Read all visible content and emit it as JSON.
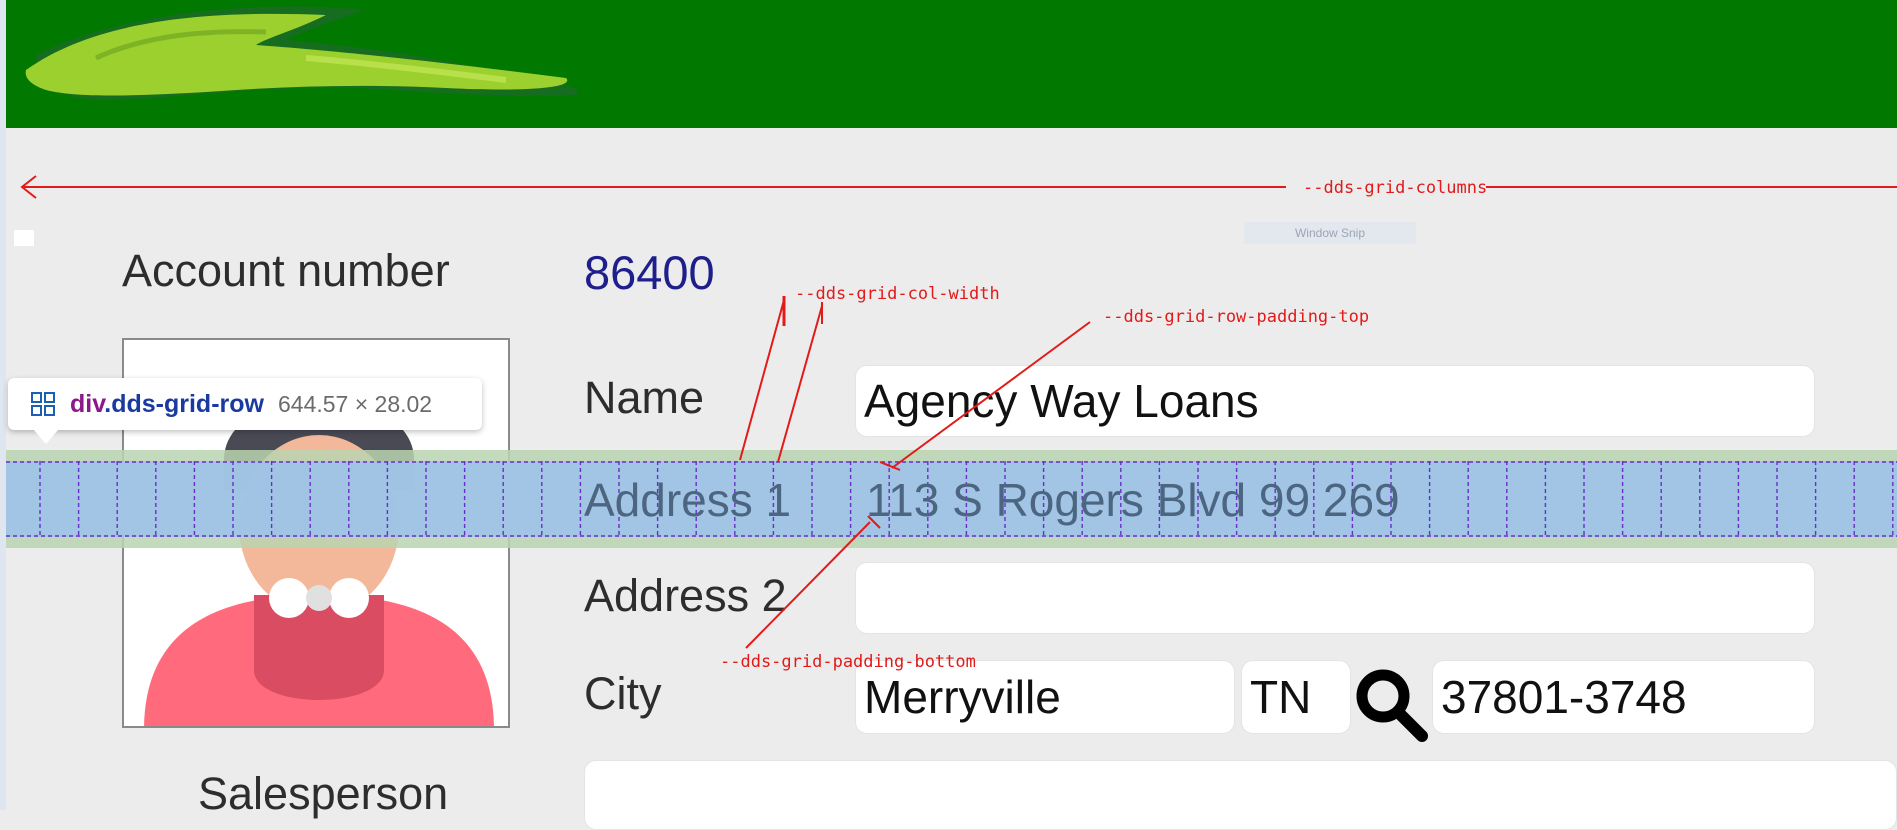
{
  "devtools": {
    "element_tag": "div",
    "element_class": ".dds-grid-row",
    "element_dims": "644.57 × 28.02"
  },
  "annotations": {
    "grid_columns": "--dds-grid-columns",
    "col_width": "--dds-grid-col-width",
    "row_padding_top": "--dds-grid-row-padding-top",
    "padding_bottom": "--dds-grid-padding-bottom"
  },
  "snip_overlay": "Window Snip",
  "form": {
    "account_label": "Account number",
    "account_value": "86400",
    "name_label": "Name",
    "name_value": "Agency Way Loans",
    "address1_label": "Address 1",
    "address1_value": "113 S Rogers Blvd 99 269",
    "address2_label": "Address 2",
    "address2_value": "",
    "city_label": "City",
    "city_value": "Merryville",
    "state_value": "TN",
    "zip_value": "37801-3748",
    "salesperson_label": "Salesperson"
  },
  "colors": {
    "banner": "#017800",
    "annotation": "#e21a1a",
    "row_highlight": "#9fc2e8",
    "row_padding": "#b9d3b0",
    "account_value": "#1e1e8c"
  },
  "icons": [
    "leaf-logo",
    "search-icon",
    "grid-icon",
    "avatar-image"
  ]
}
